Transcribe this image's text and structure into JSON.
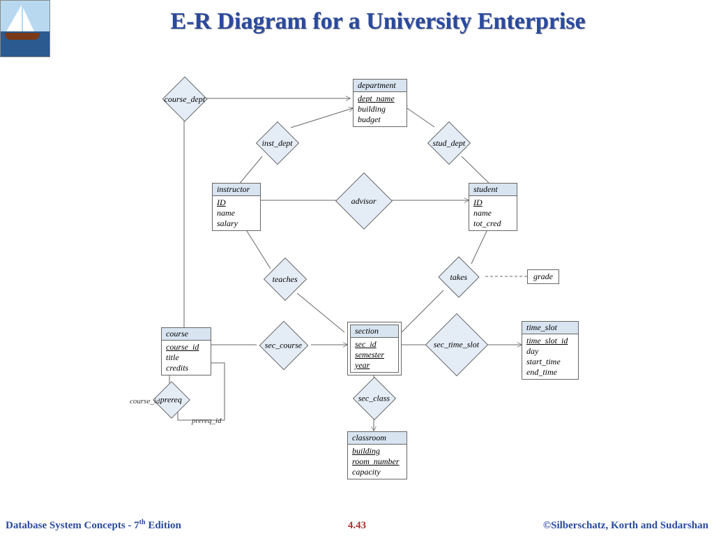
{
  "title": "E-R Diagram for a University Enterprise",
  "footer": {
    "left_book": "Database System Concepts - 7",
    "left_ed": "th",
    "left_ed2": " Edition",
    "center": "4.43",
    "right": "©Silberschatz, Korth and Sudarshan"
  },
  "entities": {
    "department": {
      "name": "department",
      "attrs": [
        "dept_name",
        "building",
        "budget"
      ],
      "keys": [
        "dept_name"
      ]
    },
    "instructor": {
      "name": "instructor",
      "attrs": [
        "ID",
        "name",
        "salary"
      ],
      "keys": [
        "ID"
      ]
    },
    "student": {
      "name": "student",
      "attrs": [
        "ID",
        "name",
        "tot_cred"
      ],
      "keys": [
        "ID"
      ]
    },
    "course": {
      "name": "course",
      "attrs": [
        "course_id",
        "title",
        "credits"
      ],
      "keys": [
        "course_id"
      ]
    },
    "section": {
      "name": "section",
      "attrs": [
        "sec_id",
        "semester",
        "year"
      ],
      "keys": [
        "sec_id",
        "semester",
        "year"
      ],
      "weak": true
    },
    "time_slot": {
      "name": "time_slot",
      "attrs": [
        "time_slot_id",
        "day",
        "start_time",
        "end_time"
      ],
      "keys": [
        "time_slot_id"
      ]
    },
    "classroom": {
      "name": "classroom",
      "attrs": [
        "building",
        "room_number",
        "capacity"
      ],
      "keys": [
        "building",
        "room_number"
      ]
    }
  },
  "relationships": {
    "course_dept": "course_dept",
    "inst_dept": "inst_dept",
    "stud_dept": "stud_dept",
    "advisor": "advisor",
    "teaches": "teaches",
    "takes": "takes",
    "sec_course": "sec_course",
    "sec_time_slot": "sec_time_slot",
    "sec_class": "sec_class",
    "prereq": "prereq"
  },
  "extra": {
    "grade": "grade",
    "course_id_role": "course_id",
    "prereq_id_role": "prereq_id"
  }
}
